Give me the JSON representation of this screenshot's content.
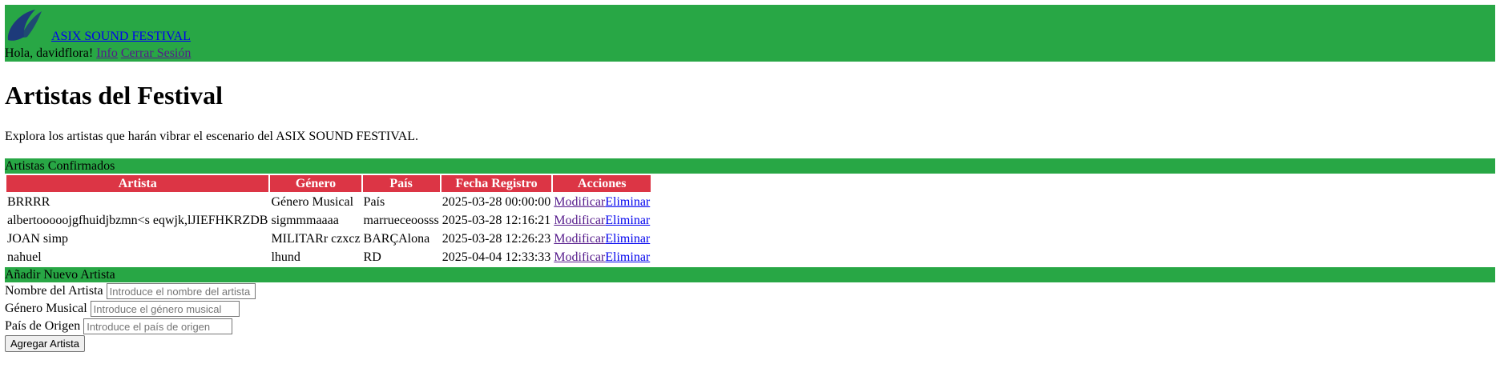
{
  "header": {
    "brand": "ASIX SOUND FESTIVAL",
    "greeting": "Hola, davidflora!",
    "info_link": "Info",
    "logout_link": "Cerrar Sesión"
  },
  "page": {
    "title": "Artistas del Festival",
    "intro": "Explora los artistas que harán vibrar el escenario del ASIX SOUND FESTIVAL."
  },
  "artists_section": {
    "title": "Artistas Confirmados",
    "columns": [
      "Artista",
      "Género",
      "País",
      "Fecha Registro",
      "Acciones"
    ],
    "rows": [
      {
        "artist": "BRRRR",
        "genre": "Género Musical",
        "country": "País",
        "date": "2025-03-28 00:00:00"
      },
      {
        "artist": "albertooooojgfhuidjbzmn<s eqwjk,lJIEFHKRZDB",
        "genre": "sigmmmaaaa",
        "country": "marrueceoosss",
        "date": "2025-03-28 12:16:21"
      },
      {
        "artist": "JOAN simp",
        "genre": "MILITARr czxcz",
        "country": "BARÇAlona",
        "date": "2025-03-28 12:26:23"
      },
      {
        "artist": "nahuel",
        "genre": "lhund",
        "country": "RD",
        "date": "2025-04-04 12:33:33"
      }
    ],
    "modify_label": "Modificar",
    "delete_label": "Eliminar"
  },
  "add_section": {
    "title": "Añadir Nuevo Artista",
    "name_label": "Nombre del Artista",
    "name_placeholder": "Introduce el nombre del artista",
    "genre_label": "Género Musical",
    "genre_placeholder": "Introduce el género musical",
    "country_label": "País de Origen",
    "country_placeholder": "Introduce el país de origen",
    "submit_label": "Agregar Artista"
  },
  "colors": {
    "green": "#28a745",
    "red": "#dc3545",
    "logo_blue": "#1d3a7a"
  },
  "icons": {
    "logo": "asics-swoosh-logo"
  }
}
